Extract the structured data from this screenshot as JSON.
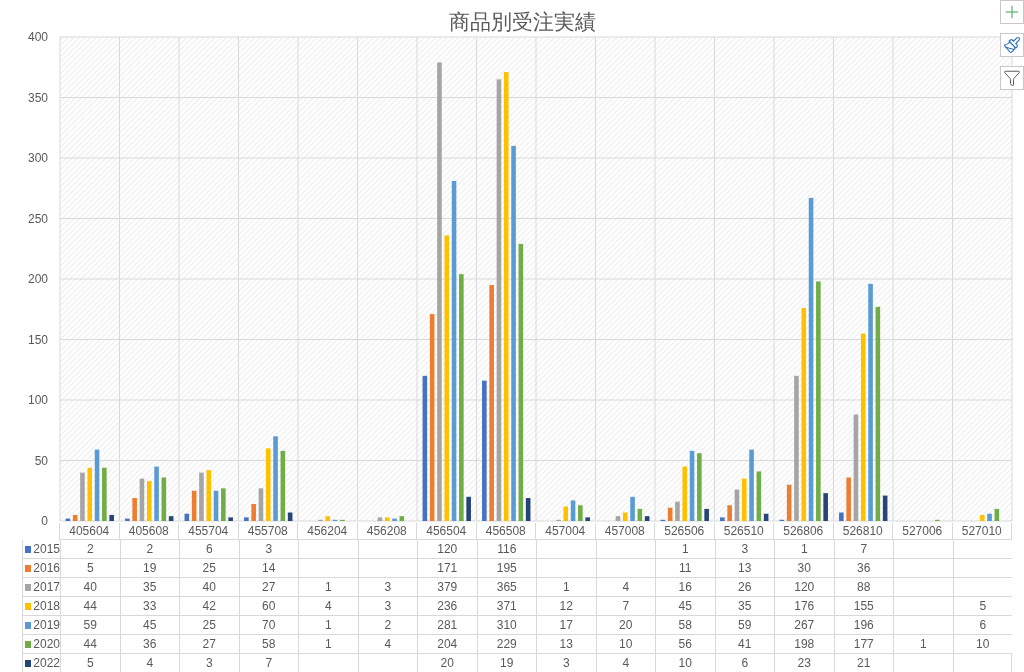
{
  "chart": {
    "chart_data": {
      "type": "bar",
      "title": "商品別受注実績",
      "categories": [
        "405604",
        "405608",
        "455704",
        "455708",
        "456204",
        "456208",
        "456504",
        "456508",
        "457004",
        "457008",
        "526506",
        "526510",
        "526806",
        "526810",
        "527006",
        "527010"
      ],
      "series": [
        {
          "name": "2015",
          "color": "#4472c4",
          "values": [
            2,
            2,
            6,
            3,
            null,
            null,
            120,
            116,
            null,
            null,
            1,
            3,
            1,
            7,
            null,
            null
          ]
        },
        {
          "name": "2016",
          "color": "#ed7d31",
          "values": [
            5,
            19,
            25,
            14,
            null,
            null,
            171,
            195,
            null,
            null,
            11,
            13,
            30,
            36,
            null,
            null
          ]
        },
        {
          "name": "2017",
          "color": "#a5a5a5",
          "values": [
            40,
            35,
            40,
            27,
            1,
            3,
            379,
            365,
            1,
            4,
            16,
            26,
            120,
            88,
            null,
            null
          ]
        },
        {
          "name": "2018",
          "color": "#ffc000",
          "values": [
            44,
            33,
            42,
            60,
            4,
            3,
            236,
            371,
            12,
            7,
            45,
            35,
            176,
            155,
            null,
            5
          ]
        },
        {
          "name": "2019",
          "color": "#5b9bd5",
          "values": [
            59,
            45,
            25,
            70,
            1,
            2,
            281,
            310,
            17,
            20,
            58,
            59,
            267,
            196,
            null,
            6
          ]
        },
        {
          "name": "2020",
          "color": "#70ad47",
          "values": [
            44,
            36,
            27,
            58,
            1,
            4,
            204,
            229,
            13,
            10,
            56,
            41,
            198,
            177,
            1,
            10
          ]
        },
        {
          "name": "2022",
          "color": "#264478",
          "values": [
            5,
            4,
            3,
            7,
            null,
            null,
            20,
            19,
            3,
            4,
            10,
            6,
            23,
            21,
            null,
            null
          ]
        }
      ],
      "ylim": [
        0,
        400
      ],
      "yticks": [
        0,
        50,
        100,
        150,
        200,
        250,
        300,
        350,
        400
      ],
      "data_labels": true,
      "grid": true,
      "legend": true
    }
  }
}
